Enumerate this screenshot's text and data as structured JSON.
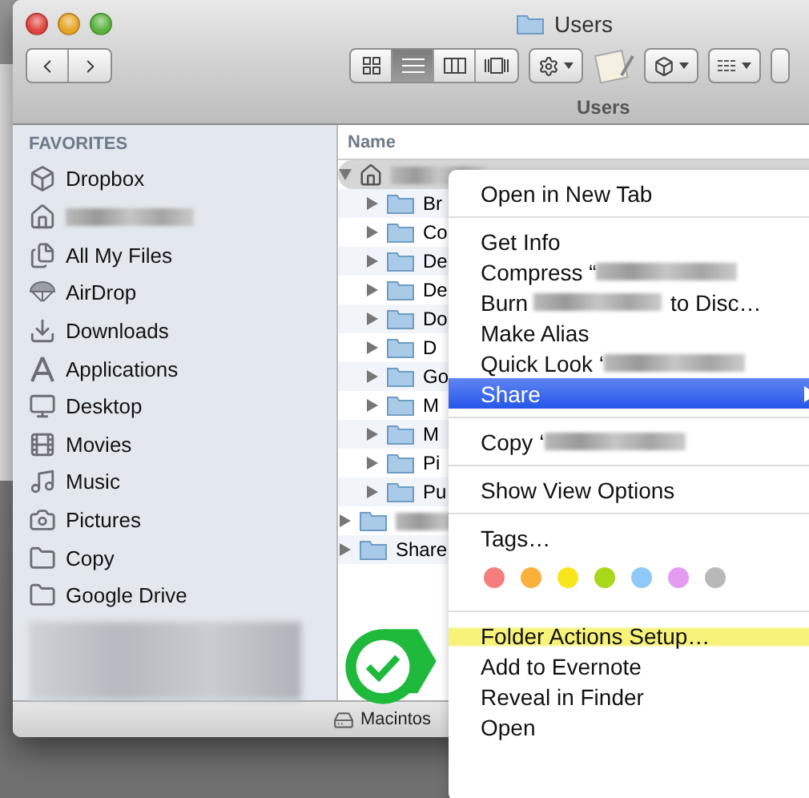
{
  "window": {
    "title": "Users",
    "tab_label": "Users"
  },
  "toolbar": {
    "view_buttons": [
      {
        "kind": "icons",
        "selected": false
      },
      {
        "kind": "list",
        "selected": true
      },
      {
        "kind": "columns",
        "selected": false
      },
      {
        "kind": "coverflow",
        "selected": false
      }
    ]
  },
  "sidebar": {
    "heading": "FAVORITES",
    "items": [
      {
        "kind": "dropbox",
        "label": "Dropbox",
        "redacted": false
      },
      {
        "kind": "home",
        "redacted": true
      },
      {
        "kind": "files",
        "label": "All My Files",
        "redacted": false
      },
      {
        "kind": "airdrop",
        "label": "AirDrop",
        "redacted": false
      },
      {
        "kind": "downloads",
        "label": "Downloads",
        "redacted": false
      },
      {
        "kind": "apps",
        "label": "Applications",
        "redacted": false
      },
      {
        "kind": "desktop",
        "label": "Desktop",
        "redacted": false
      },
      {
        "kind": "movies",
        "label": "Movies",
        "redacted": false
      },
      {
        "kind": "music",
        "label": "Music",
        "redacted": false
      },
      {
        "kind": "pictures",
        "label": "Pictures",
        "redacted": false
      },
      {
        "kind": "folder",
        "label": "Copy",
        "redacted": false
      },
      {
        "kind": "folder",
        "label": "Google Drive",
        "redacted": false
      }
    ]
  },
  "list": {
    "column": "Name",
    "rows": [
      {
        "redacted": true,
        "expanded": true,
        "selected": true,
        "children": [
          {
            "label": "Br",
            "expanded": false
          },
          {
            "label": "Co",
            "expanded": false
          },
          {
            "label": "De",
            "expanded": false
          },
          {
            "label": "De",
            "expanded": false
          },
          {
            "label": "Do",
            "expanded": false
          },
          {
            "label": "D",
            "expanded": false
          },
          {
            "label": "Go",
            "expanded": false
          },
          {
            "label": "M",
            "expanded": false
          },
          {
            "label": "M",
            "expanded": false
          },
          {
            "label": "Pi",
            "expanded": false
          },
          {
            "label": "Pu",
            "expanded": false
          }
        ]
      },
      {
        "redacted": true,
        "expanded": false,
        "selected": false,
        "children": []
      },
      {
        "label": "Share",
        "redacted": false,
        "expanded": false,
        "selected": false,
        "children": []
      }
    ]
  },
  "status_bar": {
    "disk": "Macintos"
  },
  "context_menu": [
    {
      "kind": "item",
      "label": "Open in New Tab",
      "selected": false
    },
    {
      "kind": "separator"
    },
    {
      "kind": "item",
      "label": "Get Info",
      "selected": false
    },
    {
      "kind": "item",
      "label": "Compress “",
      "redacted": true,
      "selected": false
    },
    {
      "kind": "item",
      "label": "Burn ",
      "redacted": true,
      "after": "to Disc…",
      "selected": false
    },
    {
      "kind": "item",
      "label": "Make Alias",
      "selected": false
    },
    {
      "kind": "item",
      "label": "Quick Look ‘",
      "redacted": true,
      "selected": false
    },
    {
      "kind": "item",
      "label": "Share",
      "submenu": true,
      "selected": true
    },
    {
      "kind": "separator"
    },
    {
      "kind": "item",
      "label": "Copy ‘",
      "redacted": true,
      "selected": false
    },
    {
      "kind": "separator"
    },
    {
      "kind": "item",
      "label": "Show View Options",
      "selected": false
    },
    {
      "kind": "separator"
    },
    {
      "kind": "item",
      "label": "Tags…",
      "selected": false
    },
    {
      "kind": "tags",
      "tags": [
        {
          "color": "#f47e7e"
        },
        {
          "color": "#fbb03b"
        },
        {
          "color": "#f9e51c"
        },
        {
          "color": "#a8d81a"
        },
        {
          "color": "#8ec9f7"
        },
        {
          "color": "#e49cf2"
        },
        {
          "color": "#b8b8b8"
        }
      ]
    },
    {
      "kind": "separator"
    },
    {
      "kind": "item",
      "label": "Folder Actions Setup…",
      "highlighted": true,
      "selected": false
    },
    {
      "kind": "item",
      "label": "Add to Evernote",
      "selected": false
    },
    {
      "kind": "item",
      "label": "Reveal in Finder",
      "selected": false
    },
    {
      "kind": "item",
      "label": "Open",
      "selected": false
    }
  ]
}
